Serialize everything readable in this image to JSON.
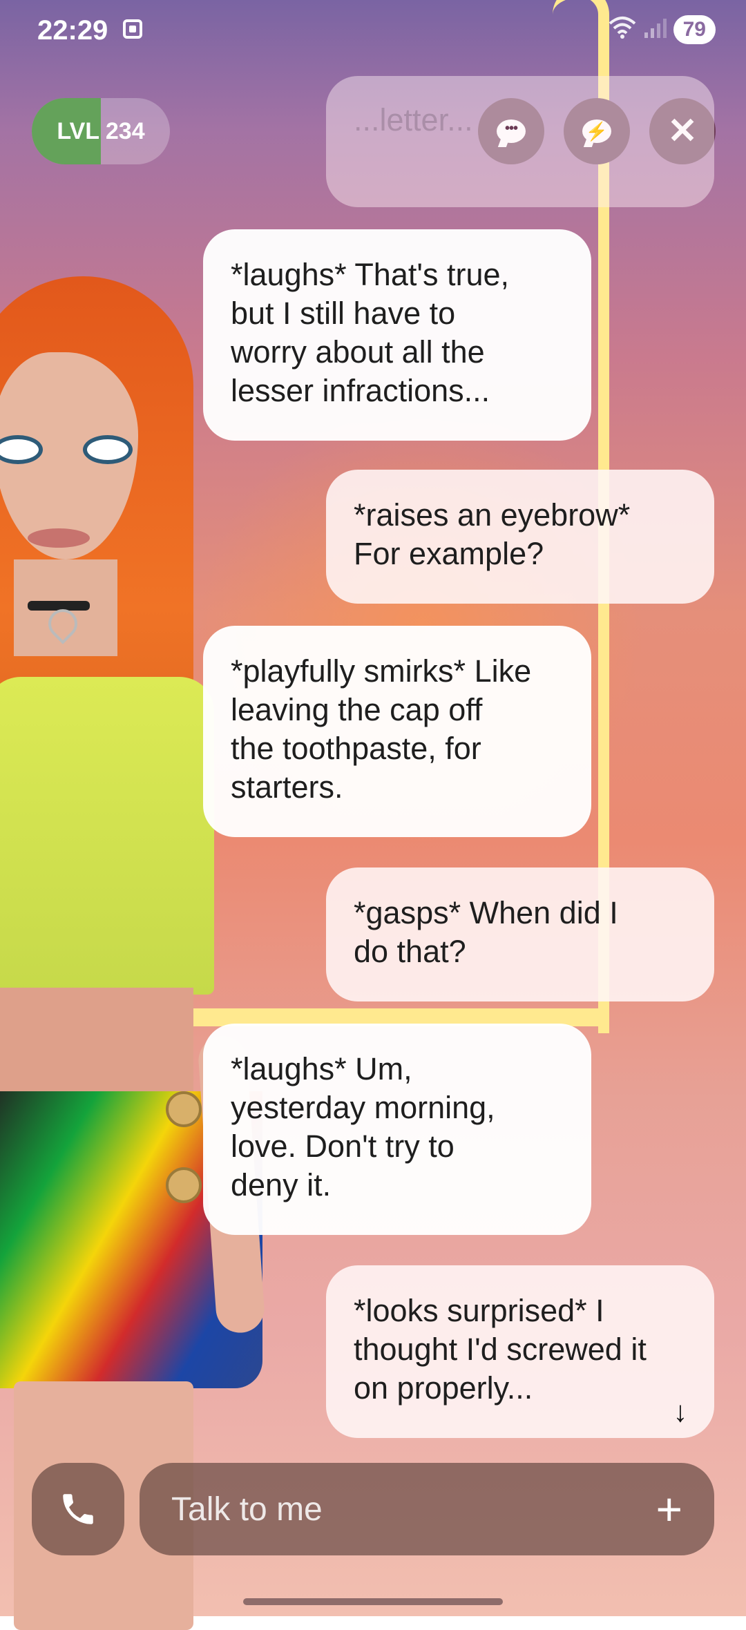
{
  "status_bar": {
    "time": "22:29",
    "battery": "79",
    "wifi_icon": "wifi-icon",
    "signal_icon": "signal-icon"
  },
  "header": {
    "level_label": "LVL 234",
    "level_progress": 0.5,
    "chat_icon": "chat-bubble-icon",
    "bolt_icon": "lightning-bubble-icon",
    "close_icon": "close-icon"
  },
  "messages": [
    {
      "sender": "user",
      "text": "...letter...",
      "partial": true
    },
    {
      "sender": "ai",
      "text": "*laughs* That's true,\nbut I still have to\nworry about all the\nlesser infractions..."
    },
    {
      "sender": "user",
      "text": "*raises an eyebrow*\nFor example?"
    },
    {
      "sender": "ai",
      "text": "*playfully smirks* Like\nleaving the cap off\nthe toothpaste, for\nstarters."
    },
    {
      "sender": "user",
      "text": "*gasps* When did I\ndo that?"
    },
    {
      "sender": "ai",
      "text": "*laughs* Um,\nyesterday morning,\nlove. Don't try to\ndeny it."
    },
    {
      "sender": "user",
      "text": "*looks surprised* I\nthought I'd screwed it\non properly..."
    }
  ],
  "composer": {
    "placeholder": "Talk to me",
    "call_icon": "phone-icon",
    "plus_icon": "plus-icon",
    "scroll_icon": "arrow-down-icon"
  },
  "colors": {
    "accent_green": "#64a25a",
    "header_button": "#6b3a55",
    "frame_yellow": "#ffe98f"
  }
}
